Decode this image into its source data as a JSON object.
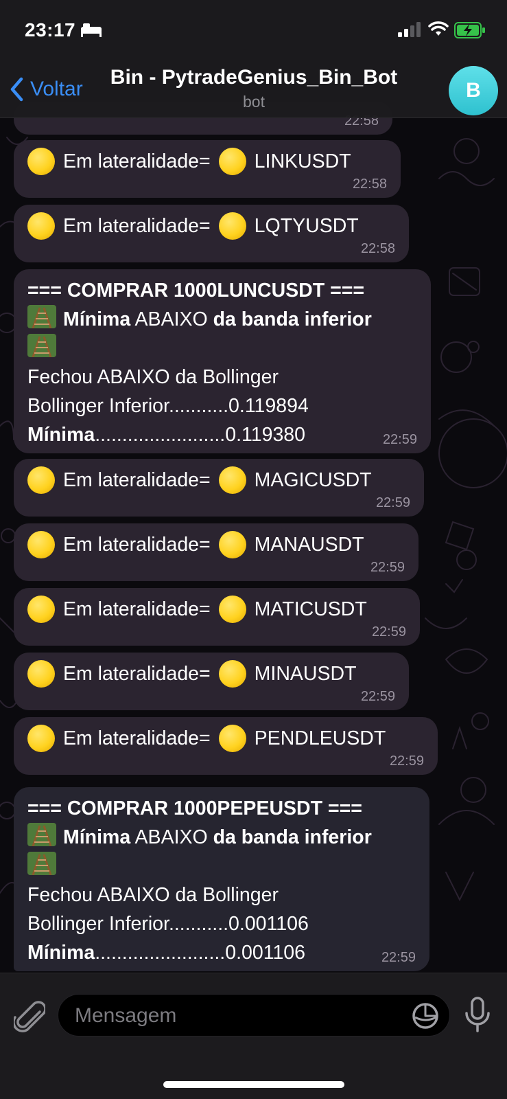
{
  "status_bar": {
    "time": "23:17"
  },
  "header": {
    "back_label": "Voltar",
    "title": "Bin - PytradeGenius_Bin_Bot",
    "subtitle": "bot",
    "avatar_letter": "B"
  },
  "colors": {
    "accent": "#3a8ef6",
    "bubble": "#2b2430",
    "avatar": "#35c6d3"
  },
  "messages": [
    {
      "time": "22:58"
    },
    {
      "prefix": "Em lateralidade=",
      "symbol": "LINKUSDT",
      "time": "22:58"
    },
    {
      "prefix": "Em lateralidade=",
      "symbol": "LQTYUSDT",
      "time": "22:58"
    },
    {
      "title": "=== COMPRAR 1000LUNCUSDT ===",
      "min_bold": "Mínima",
      "abaixo": "ABAIXO",
      "banda": "da banda inferior",
      "fechou": "Fechou ABAIXO da Bollinger",
      "boll_label": "Bollinger Inferior...........",
      "boll_value": "0.119894",
      "min_label": "Mínima",
      "min_dots": "........................",
      "min_value": "0.119380",
      "time": "22:59"
    },
    {
      "prefix": "Em lateralidade=",
      "symbol": "MAGICUSDT",
      "time": "22:59"
    },
    {
      "prefix": "Em lateralidade=",
      "symbol": "MANAUSDT",
      "time": "22:59"
    },
    {
      "prefix": "Em lateralidade=",
      "symbol": "MATICUSDT",
      "time": "22:59"
    },
    {
      "prefix": "Em lateralidade=",
      "symbol": "MINAUSDT",
      "time": "22:59"
    },
    {
      "prefix": "Em lateralidade=",
      "symbol": "PENDLEUSDT",
      "time": "22:59"
    },
    {
      "title": "=== COMPRAR 1000PEPEUSDT ===",
      "min_bold": "Mínima",
      "abaixo": "ABAIXO",
      "banda": "da banda inferior",
      "fechou": "Fechou ABAIXO da Bollinger",
      "boll_label": "Bollinger Inferior...........",
      "boll_value": "0.001106",
      "min_label": "Mínima",
      "min_dots": "........................",
      "min_value": "0.001106",
      "time": "22:59"
    }
  ],
  "composer": {
    "placeholder": "Mensagem"
  }
}
